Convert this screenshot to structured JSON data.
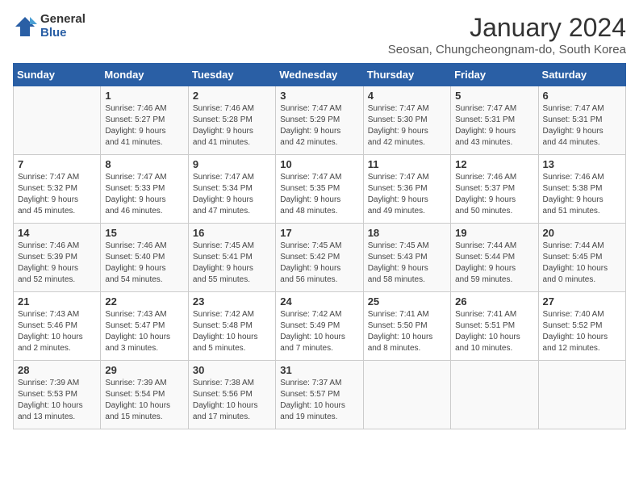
{
  "header": {
    "logo_general": "General",
    "logo_blue": "Blue",
    "title": "January 2024",
    "subtitle": "Seosan, Chungcheongnam-do, South Korea"
  },
  "calendar": {
    "weekdays": [
      "Sunday",
      "Monday",
      "Tuesday",
      "Wednesday",
      "Thursday",
      "Friday",
      "Saturday"
    ],
    "weeks": [
      [
        {
          "day": "",
          "info": ""
        },
        {
          "day": "1",
          "info": "Sunrise: 7:46 AM\nSunset: 5:27 PM\nDaylight: 9 hours\nand 41 minutes."
        },
        {
          "day": "2",
          "info": "Sunrise: 7:46 AM\nSunset: 5:28 PM\nDaylight: 9 hours\nand 41 minutes."
        },
        {
          "day": "3",
          "info": "Sunrise: 7:47 AM\nSunset: 5:29 PM\nDaylight: 9 hours\nand 42 minutes."
        },
        {
          "day": "4",
          "info": "Sunrise: 7:47 AM\nSunset: 5:30 PM\nDaylight: 9 hours\nand 42 minutes."
        },
        {
          "day": "5",
          "info": "Sunrise: 7:47 AM\nSunset: 5:31 PM\nDaylight: 9 hours\nand 43 minutes."
        },
        {
          "day": "6",
          "info": "Sunrise: 7:47 AM\nSunset: 5:31 PM\nDaylight: 9 hours\nand 44 minutes."
        }
      ],
      [
        {
          "day": "7",
          "info": "Sunrise: 7:47 AM\nSunset: 5:32 PM\nDaylight: 9 hours\nand 45 minutes."
        },
        {
          "day": "8",
          "info": "Sunrise: 7:47 AM\nSunset: 5:33 PM\nDaylight: 9 hours\nand 46 minutes."
        },
        {
          "day": "9",
          "info": "Sunrise: 7:47 AM\nSunset: 5:34 PM\nDaylight: 9 hours\nand 47 minutes."
        },
        {
          "day": "10",
          "info": "Sunrise: 7:47 AM\nSunset: 5:35 PM\nDaylight: 9 hours\nand 48 minutes."
        },
        {
          "day": "11",
          "info": "Sunrise: 7:47 AM\nSunset: 5:36 PM\nDaylight: 9 hours\nand 49 minutes."
        },
        {
          "day": "12",
          "info": "Sunrise: 7:46 AM\nSunset: 5:37 PM\nDaylight: 9 hours\nand 50 minutes."
        },
        {
          "day": "13",
          "info": "Sunrise: 7:46 AM\nSunset: 5:38 PM\nDaylight: 9 hours\nand 51 minutes."
        }
      ],
      [
        {
          "day": "14",
          "info": "Sunrise: 7:46 AM\nSunset: 5:39 PM\nDaylight: 9 hours\nand 52 minutes."
        },
        {
          "day": "15",
          "info": "Sunrise: 7:46 AM\nSunset: 5:40 PM\nDaylight: 9 hours\nand 54 minutes."
        },
        {
          "day": "16",
          "info": "Sunrise: 7:45 AM\nSunset: 5:41 PM\nDaylight: 9 hours\nand 55 minutes."
        },
        {
          "day": "17",
          "info": "Sunrise: 7:45 AM\nSunset: 5:42 PM\nDaylight: 9 hours\nand 56 minutes."
        },
        {
          "day": "18",
          "info": "Sunrise: 7:45 AM\nSunset: 5:43 PM\nDaylight: 9 hours\nand 58 minutes."
        },
        {
          "day": "19",
          "info": "Sunrise: 7:44 AM\nSunset: 5:44 PM\nDaylight: 9 hours\nand 59 minutes."
        },
        {
          "day": "20",
          "info": "Sunrise: 7:44 AM\nSunset: 5:45 PM\nDaylight: 10 hours\nand 0 minutes."
        }
      ],
      [
        {
          "day": "21",
          "info": "Sunrise: 7:43 AM\nSunset: 5:46 PM\nDaylight: 10 hours\nand 2 minutes."
        },
        {
          "day": "22",
          "info": "Sunrise: 7:43 AM\nSunset: 5:47 PM\nDaylight: 10 hours\nand 3 minutes."
        },
        {
          "day": "23",
          "info": "Sunrise: 7:42 AM\nSunset: 5:48 PM\nDaylight: 10 hours\nand 5 minutes."
        },
        {
          "day": "24",
          "info": "Sunrise: 7:42 AM\nSunset: 5:49 PM\nDaylight: 10 hours\nand 7 minutes."
        },
        {
          "day": "25",
          "info": "Sunrise: 7:41 AM\nSunset: 5:50 PM\nDaylight: 10 hours\nand 8 minutes."
        },
        {
          "day": "26",
          "info": "Sunrise: 7:41 AM\nSunset: 5:51 PM\nDaylight: 10 hours\nand 10 minutes."
        },
        {
          "day": "27",
          "info": "Sunrise: 7:40 AM\nSunset: 5:52 PM\nDaylight: 10 hours\nand 12 minutes."
        }
      ],
      [
        {
          "day": "28",
          "info": "Sunrise: 7:39 AM\nSunset: 5:53 PM\nDaylight: 10 hours\nand 13 minutes."
        },
        {
          "day": "29",
          "info": "Sunrise: 7:39 AM\nSunset: 5:54 PM\nDaylight: 10 hours\nand 15 minutes."
        },
        {
          "day": "30",
          "info": "Sunrise: 7:38 AM\nSunset: 5:56 PM\nDaylight: 10 hours\nand 17 minutes."
        },
        {
          "day": "31",
          "info": "Sunrise: 7:37 AM\nSunset: 5:57 PM\nDaylight: 10 hours\nand 19 minutes."
        },
        {
          "day": "",
          "info": ""
        },
        {
          "day": "",
          "info": ""
        },
        {
          "day": "",
          "info": ""
        }
      ]
    ]
  }
}
